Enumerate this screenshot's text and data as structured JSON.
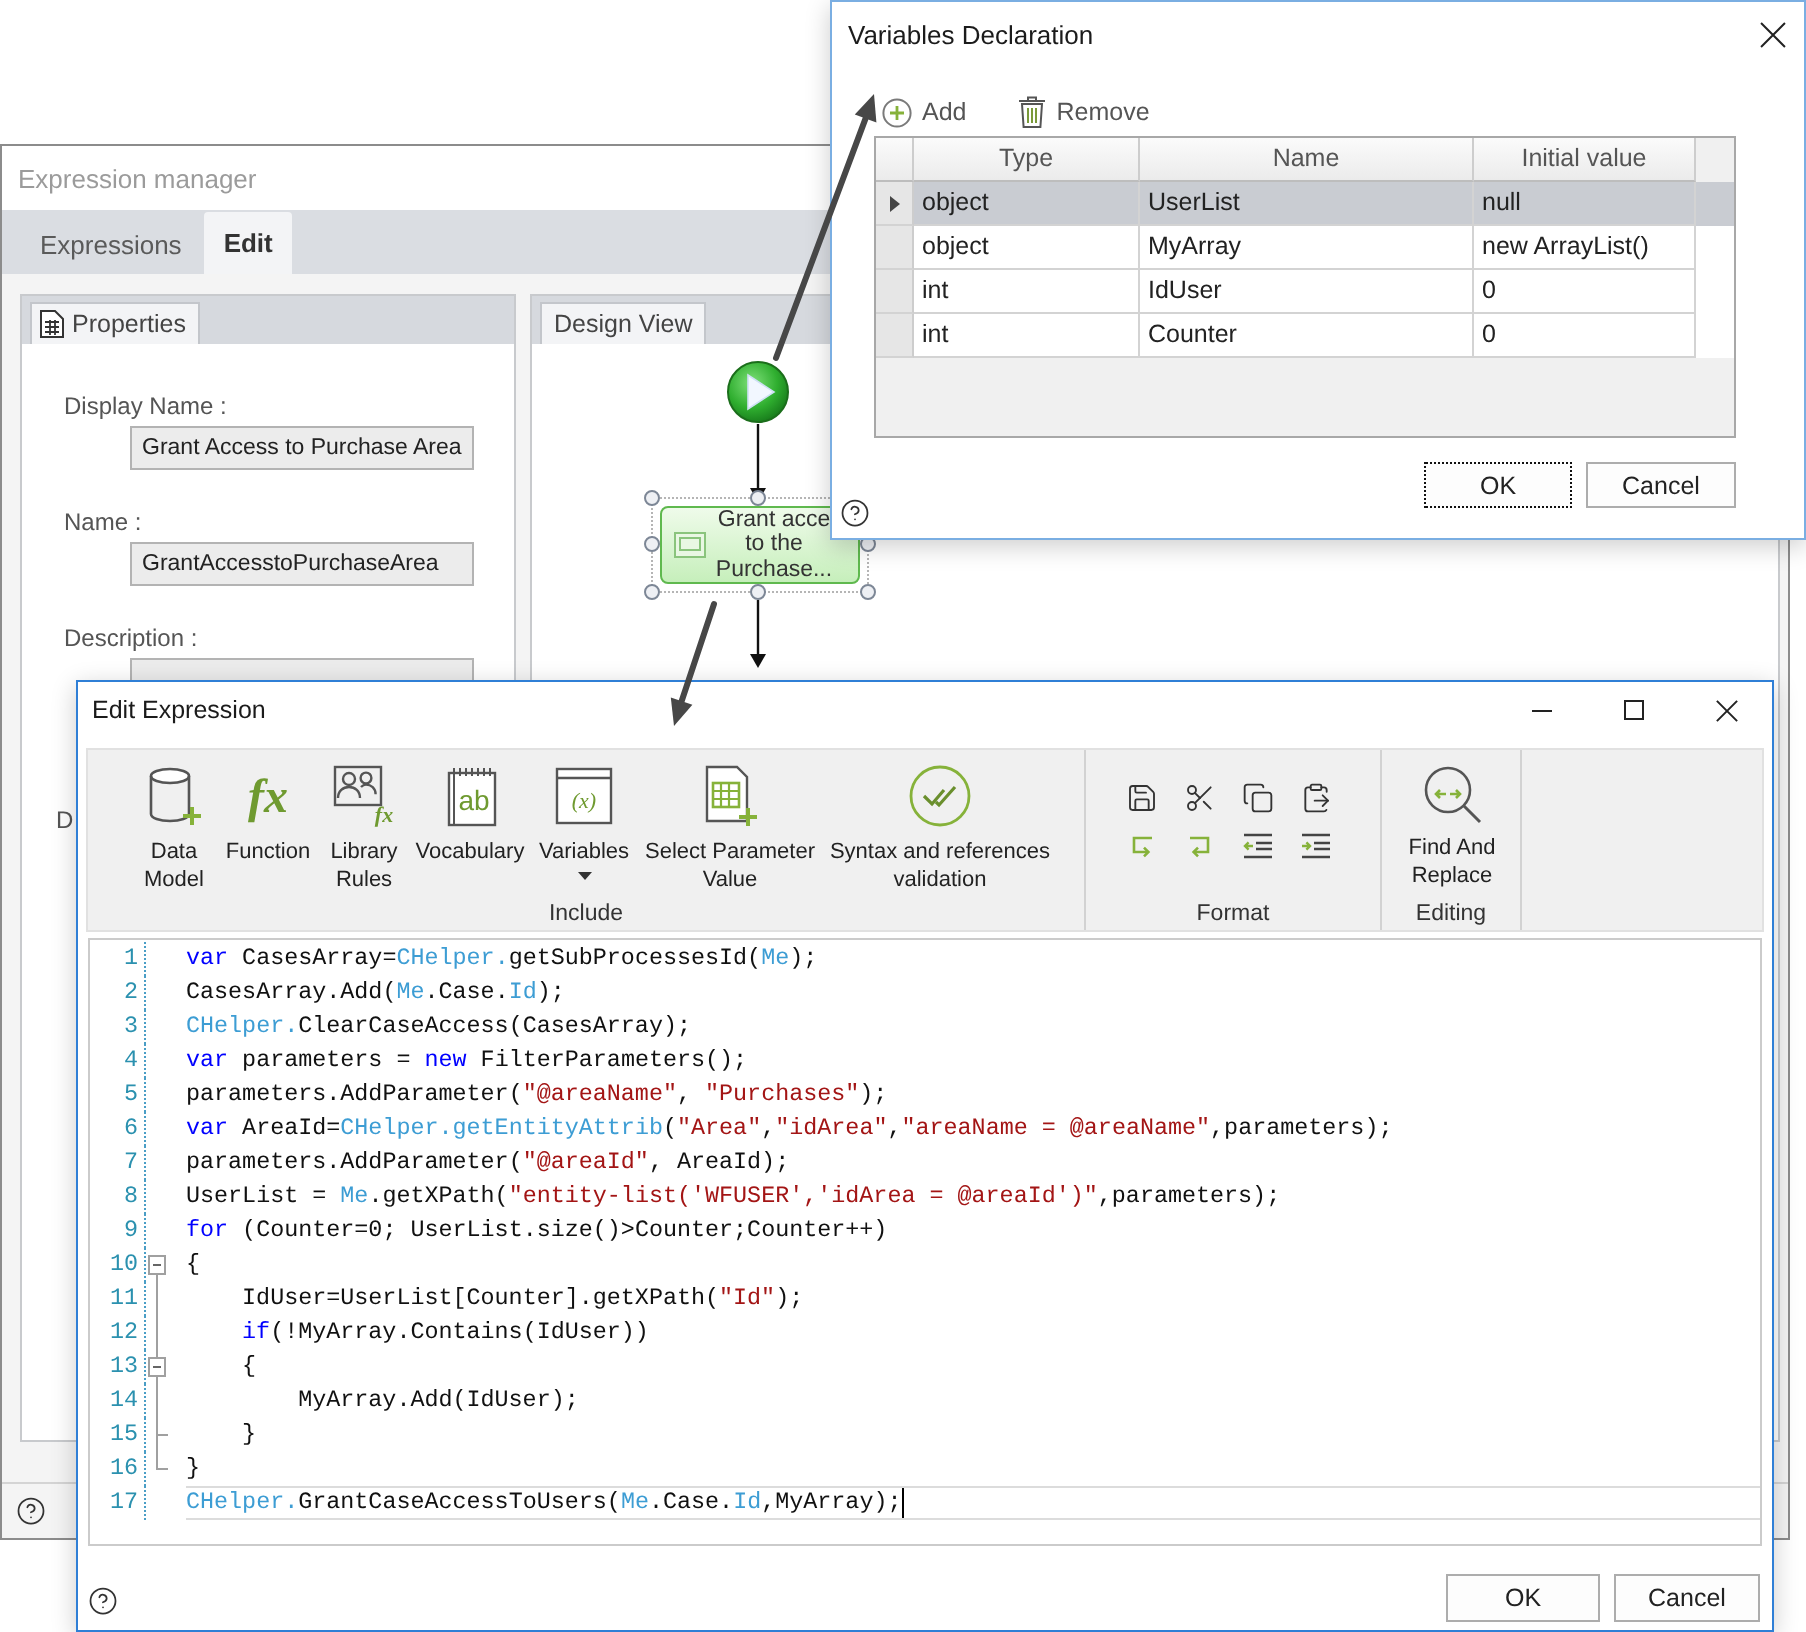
{
  "expression_manager": {
    "title": "Expression manager",
    "tabs": [
      {
        "label": "Expressions",
        "selected": false
      },
      {
        "label": "Edit",
        "selected": true
      }
    ],
    "properties": {
      "tab": "Properties",
      "fields": [
        {
          "kind": "single",
          "label": "Display Name :",
          "value": "Grant Access to Purchase Area"
        },
        {
          "kind": "single",
          "label": "Name :",
          "value": "GrantAccesstoPurchaseArea"
        },
        {
          "kind": "multi",
          "label": "Description :"
        },
        {
          "kind": "label",
          "label": "D"
        }
      ]
    },
    "design_view": {
      "tab": "Design View",
      "task_node": {
        "label": "Grant acce to the Purchase...",
        "selected": true
      }
    }
  },
  "variables_declaration": {
    "title": "Variables Declaration",
    "toolbar": [
      {
        "kind": "add",
        "label": "Add"
      },
      {
        "kind": "remove",
        "label": "Remove"
      }
    ],
    "table": {
      "columns": [
        "Type",
        "Name",
        "Initial value"
      ],
      "rows": [
        {
          "selected": true,
          "cells": [
            "object",
            "UserList",
            "null"
          ]
        },
        {
          "selected": false,
          "cells": [
            "object",
            "MyArray",
            "new ArrayList()"
          ]
        },
        {
          "selected": false,
          "cells": [
            "int",
            "IdUser",
            "0"
          ]
        },
        {
          "selected": false,
          "cells": [
            "int",
            "Counter",
            "0"
          ]
        }
      ]
    },
    "buttons": [
      {
        "label": "OK",
        "focused": true
      },
      {
        "label": "Cancel",
        "focused": false
      }
    ]
  },
  "edit_expression": {
    "title": "Edit Expression",
    "ribbon": [
      {
        "kind": "large",
        "label": "Include",
        "buttons": [
          {
            "label": "Data Model",
            "dropdown": false
          },
          {
            "label": "Function",
            "glyph": "fx",
            "dropdown": false
          },
          {
            "label": "Library Rules",
            "glyph": "fx",
            "dropdown": false
          },
          {
            "label": "Vocabulary",
            "glyph": "ab",
            "dropdown": false
          },
          {
            "label": "Variables",
            "glyph": "(x)",
            "dropdown": true
          },
          {
            "label": "Select Parameter Value",
            "dropdown": false
          },
          {
            "label": "Syntax and references validation",
            "dropdown": false
          }
        ]
      },
      {
        "kind": "small",
        "label": "Format"
      },
      {
        "kind": "large",
        "label": "Editing",
        "buttons": [
          {
            "label": "Find And Replace",
            "dropdown": false
          }
        ]
      }
    ],
    "code_lines": [
      {
        "number": "1",
        "current": false,
        "tokens": [
          {
            "kind": "keyword",
            "text": "var"
          },
          {
            "kind": "plain",
            "text": " CasesArray="
          },
          {
            "kind": "object",
            "text": "CHelper."
          },
          {
            "kind": "plain",
            "text": "getSubProcessesId("
          },
          {
            "kind": "object",
            "text": "Me"
          },
          {
            "kind": "plain",
            "text": ");"
          }
        ]
      },
      {
        "number": "2",
        "current": false,
        "tokens": [
          {
            "kind": "plain",
            "text": "CasesArray.Add("
          },
          {
            "kind": "object",
            "text": "Me"
          },
          {
            "kind": "plain",
            "text": ".Case."
          },
          {
            "kind": "object",
            "text": "Id"
          },
          {
            "kind": "plain",
            "text": ");"
          }
        ]
      },
      {
        "number": "3",
        "current": false,
        "tokens": [
          {
            "kind": "object",
            "text": "CHelper."
          },
          {
            "kind": "plain",
            "text": "ClearCaseAccess(CasesArray);"
          }
        ]
      },
      {
        "number": "4",
        "current": false,
        "tokens": [
          {
            "kind": "keyword",
            "text": "var"
          },
          {
            "kind": "plain",
            "text": " parameters = "
          },
          {
            "kind": "keyword",
            "text": "new"
          },
          {
            "kind": "plain",
            "text": " FilterParameters();"
          }
        ]
      },
      {
        "number": "5",
        "current": false,
        "tokens": [
          {
            "kind": "plain",
            "text": "parameters.AddParameter("
          },
          {
            "kind": "string",
            "text": "\"@areaName\""
          },
          {
            "kind": "plain",
            "text": ", "
          },
          {
            "kind": "string",
            "text": "\"Purchases\""
          },
          {
            "kind": "plain",
            "text": ");"
          }
        ]
      },
      {
        "number": "6",
        "current": false,
        "tokens": [
          {
            "kind": "keyword",
            "text": "var"
          },
          {
            "kind": "plain",
            "text": " AreaId="
          },
          {
            "kind": "object",
            "text": "CHelper.getEntityAttrib"
          },
          {
            "kind": "plain",
            "text": "("
          },
          {
            "kind": "string",
            "text": "\"Area\""
          },
          {
            "kind": "plain",
            "text": ","
          },
          {
            "kind": "string",
            "text": "\"idArea\""
          },
          {
            "kind": "plain",
            "text": ","
          },
          {
            "kind": "string",
            "text": "\"areaName = @areaName\""
          },
          {
            "kind": "plain",
            "text": ",parameters);"
          }
        ]
      },
      {
        "number": "7",
        "current": false,
        "tokens": [
          {
            "kind": "plain",
            "text": "parameters.AddParameter("
          },
          {
            "kind": "string",
            "text": "\"@areaId\""
          },
          {
            "kind": "plain",
            "text": ", AreaId);"
          }
        ]
      },
      {
        "number": "8",
        "current": false,
        "tokens": [
          {
            "kind": "plain",
            "text": "UserList = "
          },
          {
            "kind": "object",
            "text": "Me"
          },
          {
            "kind": "plain",
            "text": ".getXPath("
          },
          {
            "kind": "string",
            "text": "\"entity-list('WFUSER','idArea = @areaId')\""
          },
          {
            "kind": "plain",
            "text": ",parameters);"
          }
        ]
      },
      {
        "number": "9",
        "current": false,
        "tokens": [
          {
            "kind": "keyword",
            "text": "for"
          },
          {
            "kind": "plain",
            "text": " (Counter=0; UserList.size()>Counter;Counter++)"
          }
        ]
      },
      {
        "number": "10",
        "current": false,
        "expanded": true,
        "tokens": [
          {
            "kind": "plain",
            "text": "{"
          }
        ],
        "children": [
          {
            "number": "11",
            "current": false,
            "tokens": [
              {
                "kind": "plain",
                "text": "IdUser=UserList[Counter].getXPath("
              },
              {
                "kind": "string",
                "text": "\"Id\""
              },
              {
                "kind": "plain",
                "text": ");"
              }
            ]
          },
          {
            "number": "12",
            "current": false,
            "tokens": [
              {
                "kind": "keyword",
                "text": "if"
              },
              {
                "kind": "plain",
                "text": "(!MyArray.Contains(IdUser))"
              }
            ]
          },
          {
            "number": "13",
            "current": false,
            "expanded": true,
            "tokens": [
              {
                "kind": "plain",
                "text": "{"
              }
            ],
            "children": [
              {
                "number": "14",
                "current": false,
                "tokens": [
                  {
                    "kind": "plain",
                    "text": "MyArray.Add(IdUser);"
                  }
                ]
              }
            ]
          },
          {
            "number": "15",
            "current": false,
            "tokens": [
              {
                "kind": "plain",
                "text": "}"
              }
            ]
          }
        ]
      },
      {
        "number": "16",
        "current": false,
        "tokens": [
          {
            "kind": "plain",
            "text": "}"
          }
        ]
      },
      {
        "number": "17",
        "current": true,
        "tokens": [
          {
            "kind": "object",
            "text": "CHelper."
          },
          {
            "kind": "plain",
            "text": "GrantCaseAccessToUsers("
          },
          {
            "kind": "object",
            "text": "Me"
          },
          {
            "kind": "plain",
            "text": ".Case."
          },
          {
            "kind": "object",
            "text": "Id"
          },
          {
            "kind": "plain",
            "text": ",MyArray);"
          }
        ]
      }
    ],
    "buttons": [
      {
        "label": "OK",
        "focused": false
      },
      {
        "label": "Cancel",
        "focused": false
      }
    ]
  }
}
